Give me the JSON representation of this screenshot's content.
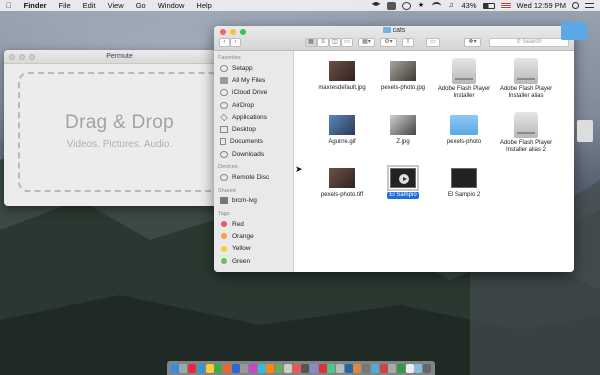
{
  "menubar": {
    "app": "Finder",
    "menus": [
      "File",
      "Edit",
      "View",
      "Go",
      "Window",
      "Help"
    ],
    "battery": "43%",
    "clock": "Wed 12:59 PM"
  },
  "permute": {
    "title": "Permute",
    "drop_title": "Drag & Drop",
    "drop_sub": "Videos. Pictures. Audio."
  },
  "finder": {
    "title": "cats",
    "search_placeholder": "Search",
    "sidebar": {
      "favorites_label": "Favorites",
      "favorites": [
        "Setapp",
        "All My Files",
        "iCloud Drive",
        "AirDrop",
        "Applications",
        "Desktop",
        "Documents",
        "Downloads"
      ],
      "devices_label": "Devices",
      "devices": [
        "Remote Disc"
      ],
      "shared_label": "Shared",
      "shared": [
        "brcm-lvg"
      ],
      "tags_label": "Tags",
      "tags": [
        {
          "name": "Red",
          "color": "#f0575b"
        },
        {
          "name": "Orange",
          "color": "#f7a33c"
        },
        {
          "name": "Yellow",
          "color": "#f4cf3c"
        },
        {
          "name": "Green",
          "color": "#5cc85a"
        }
      ]
    },
    "files": [
      {
        "name": "maxresdefault.jpg",
        "kind": "photo",
        "selected": false
      },
      {
        "name": "pexels-photo.jpg",
        "kind": "photo2",
        "selected": false
      },
      {
        "name": "Adobe Flash Player Installer",
        "kind": "drive",
        "selected": false
      },
      {
        "name": "Adobe Flash Player Installer alias",
        "kind": "drive",
        "selected": false
      },
      {
        "name": "Aguirre.gif",
        "kind": "photo3",
        "selected": false
      },
      {
        "name": "Z.jpg",
        "kind": "photo4",
        "selected": false
      },
      {
        "name": "pexels-photo",
        "kind": "folder",
        "selected": false
      },
      {
        "name": "Adobe Flash Player Installer alias 2",
        "kind": "drive",
        "selected": false
      },
      {
        "name": "pexels-photo.tiff",
        "kind": "photo",
        "selected": false
      },
      {
        "name": "El Sampio",
        "kind": "video",
        "selected": true
      },
      {
        "name": "El Sampio 2",
        "kind": "video",
        "selected": false
      }
    ]
  },
  "dock_colors": [
    "#3d8be0",
    "#9aa",
    "#e24",
    "#39c",
    "#fc3",
    "#4a4",
    "#e63",
    "#36c",
    "#999",
    "#c4c",
    "#3bd",
    "#f80",
    "#6a6",
    "#ccc",
    "#e55",
    "#555",
    "#88c",
    "#d33",
    "#4c8",
    "#bbb",
    "#26a",
    "#d84",
    "#777",
    "#5ad",
    "#c44",
    "#aaa",
    "#394",
    "#eee",
    "#8bd",
    "#666"
  ]
}
